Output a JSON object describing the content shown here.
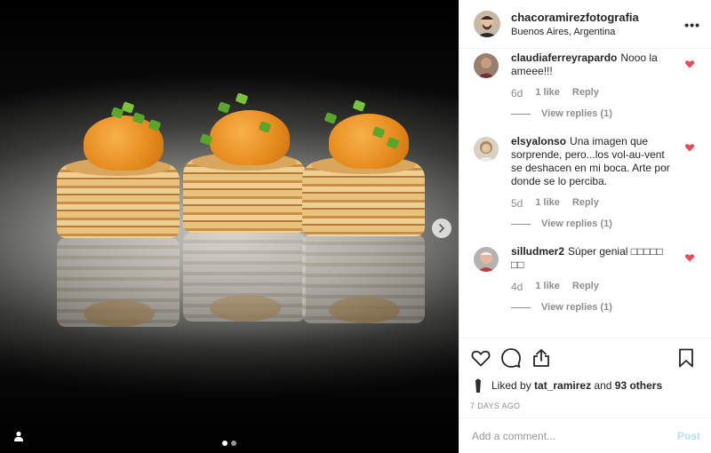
{
  "post": {
    "username": "chacoramirezfotografia",
    "location": "Buenos Aires, Argentina",
    "more_label": "•••"
  },
  "carousel": {
    "total_slides": 2,
    "active_slide": 1,
    "next_icon": "chevron-right-icon",
    "tag_icon": "user-tag-icon"
  },
  "comments": [
    {
      "author": "claudiaferreyrapardo",
      "text": "Nooo la ameee!!!",
      "age": "6d",
      "likes": "1 like",
      "reply_label": "Reply",
      "view_replies": "View replies (1)"
    },
    {
      "author": "elsyalonso",
      "text": "Una imagen que sorprende, pero...los vol-au-vent se deshacen en mi boca. Arte por donde se lo perciba.",
      "age": "5d",
      "likes": "1 like",
      "reply_label": "Reply",
      "view_replies": "View replies (1)"
    },
    {
      "author": "silludmer2",
      "text": "Súper genial □□□□□ □□",
      "age": "4d",
      "likes": "1 like",
      "reply_label": "Reply",
      "view_replies": "View replies (1)"
    }
  ],
  "actions": {
    "like_icon": "heart-outline-icon",
    "comment_icon": "comment-icon",
    "share_icon": "share-icon",
    "save_icon": "bookmark-icon"
  },
  "likes_line": {
    "prefix": "Liked by",
    "user": "tat_ramirez",
    "connector": "and",
    "others": "93 others"
  },
  "timestamp": "7 DAYS AGO",
  "comment_box": {
    "placeholder": "Add a comment...",
    "post_label": "Post"
  },
  "colors": {
    "heart_red": "#ed4956",
    "post_disabled": "#b2dffc",
    "muted": "#8e8e8e"
  }
}
